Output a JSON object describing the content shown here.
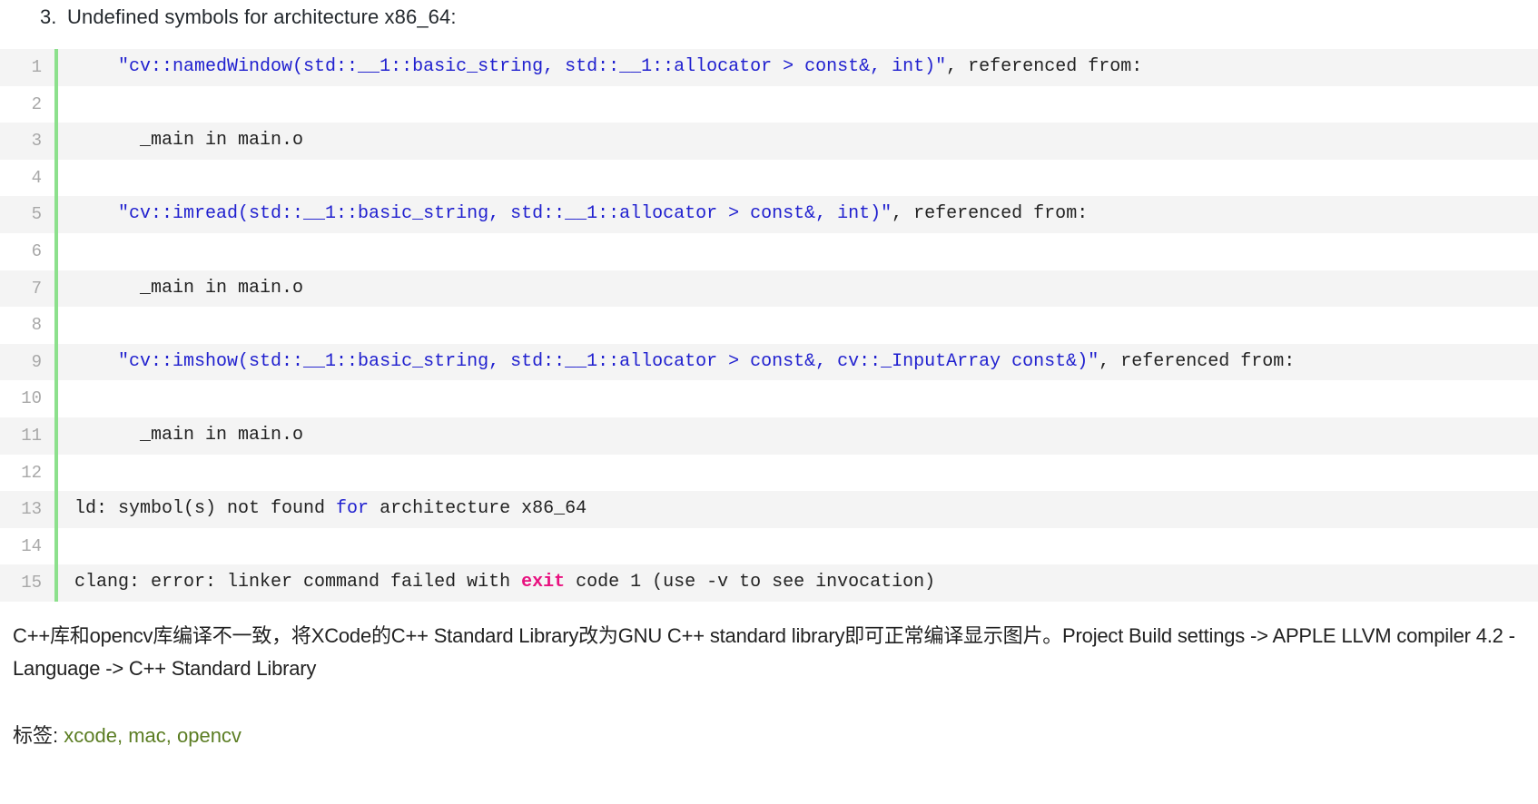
{
  "heading": {
    "number": "3.",
    "text": "Undefined symbols for architecture x86_64:"
  },
  "code_block": {
    "language": "build-log",
    "gutter_accent_color": "#8ce08c",
    "stripe_color": "#f4f4f4",
    "lines": [
      {
        "number": "1",
        "text": "    \"cv::namedWindow(std::__1::basic_string, std::__1::allocator > const&, int)\", referenced from:",
        "segments": [
          {
            "t": "    ",
            "c": "plain"
          },
          {
            "t": "\"cv::namedWindow(std::__1::basic_string, std::__1::allocator > const&, int)\"",
            "c": "str"
          },
          {
            "t": ", referenced from:",
            "c": "plain"
          }
        ]
      },
      {
        "number": "2",
        "text": "",
        "segments": []
      },
      {
        "number": "3",
        "text": "      _main in main.o",
        "segments": [
          {
            "t": "      _main in main.o",
            "c": "plain"
          }
        ]
      },
      {
        "number": "4",
        "text": "",
        "segments": []
      },
      {
        "number": "5",
        "text": "    \"cv::imread(std::__1::basic_string, std::__1::allocator > const&, int)\", referenced from:",
        "segments": [
          {
            "t": "    ",
            "c": "plain"
          },
          {
            "t": "\"cv::imread(std::__1::basic_string, std::__1::allocator > const&, int)\"",
            "c": "str"
          },
          {
            "t": ", referenced from:",
            "c": "plain"
          }
        ]
      },
      {
        "number": "6",
        "text": "",
        "segments": []
      },
      {
        "number": "7",
        "text": "      _main in main.o",
        "segments": [
          {
            "t": "      _main in main.o",
            "c": "plain"
          }
        ]
      },
      {
        "number": "8",
        "text": "",
        "segments": []
      },
      {
        "number": "9",
        "text": "    \"cv::imshow(std::__1::basic_string, std::__1::allocator > const&, cv::_InputArray const&)\", referenced from:",
        "segments": [
          {
            "t": "    ",
            "c": "plain"
          },
          {
            "t": "\"cv::imshow(std::__1::basic_string, std::__1::allocator > const&, cv::_InputArray const&)\"",
            "c": "str"
          },
          {
            "t": ", referenced from:",
            "c": "plain"
          }
        ]
      },
      {
        "number": "10",
        "text": "",
        "segments": []
      },
      {
        "number": "11",
        "text": "      _main in main.o",
        "segments": [
          {
            "t": "      _main in main.o",
            "c": "plain"
          }
        ]
      },
      {
        "number": "12",
        "text": "",
        "segments": []
      },
      {
        "number": "13",
        "text": "ld: symbol(s) not found for architecture x86_64",
        "segments": [
          {
            "t": "ld: symbol(s) not found ",
            "c": "plain"
          },
          {
            "t": "for",
            "c": "kw"
          },
          {
            "t": " architecture x86_64",
            "c": "plain"
          }
        ]
      },
      {
        "number": "14",
        "text": "",
        "segments": []
      },
      {
        "number": "15",
        "text": "clang: error: linker command failed with exit code 1 (use -v to see invocation)",
        "segments": [
          {
            "t": "clang: error: linker command failed with ",
            "c": "plain"
          },
          {
            "t": "exit",
            "c": "exit"
          },
          {
            "t": " code 1 (use -v to see invocation)",
            "c": "plain"
          }
        ]
      }
    ]
  },
  "explanation": {
    "paragraph": "C++库和opencv库编译不一致，将XCode的C++ Standard Library改为GNU C++ standard library即可正常编译显示图片。Project Build settings -> APPLE LLVM compiler 4.2 - Language -> C++ Standard Library"
  },
  "tags": {
    "label": "标签: ",
    "color": "#5b7d23",
    "separator": ", ",
    "items": [
      {
        "name": "xcode"
      },
      {
        "name": "mac"
      },
      {
        "name": "opencv"
      }
    ]
  }
}
